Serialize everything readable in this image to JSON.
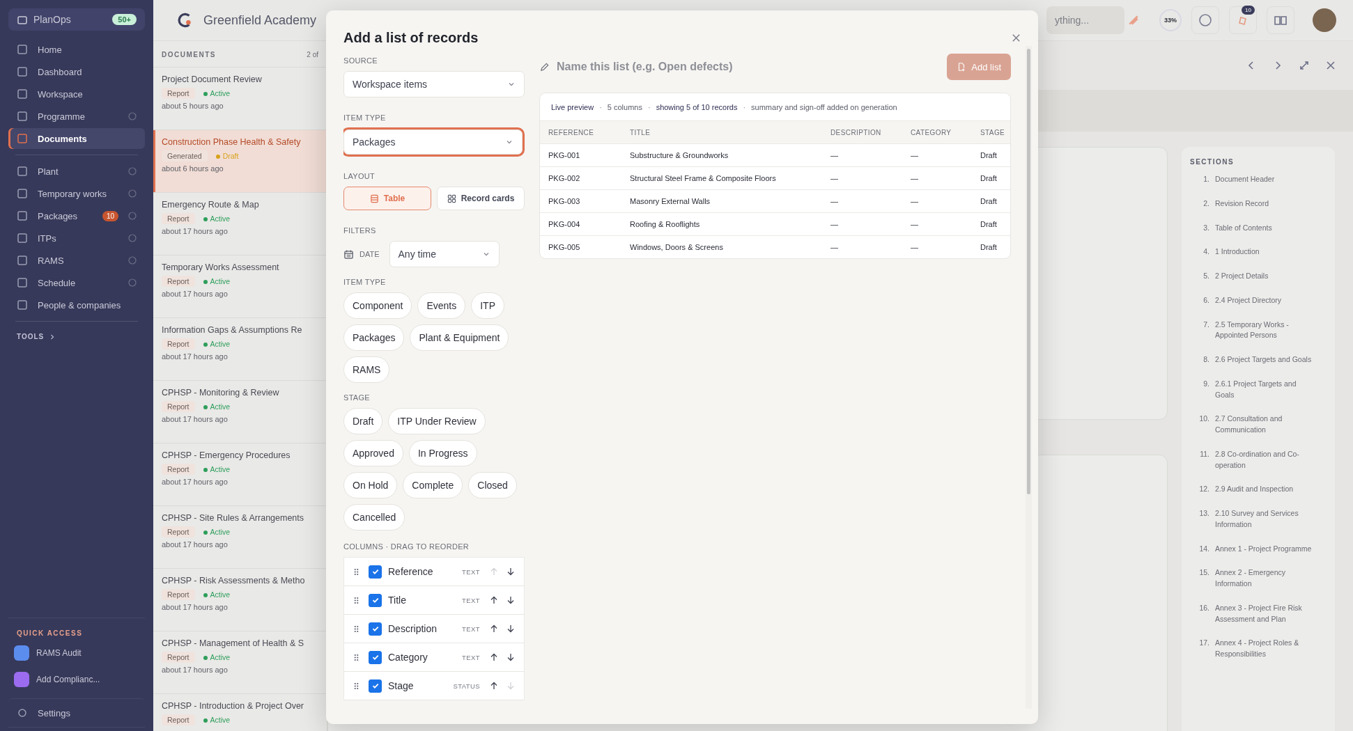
{
  "sidebar": {
    "brand": "PlanOps",
    "brand_badge": "50+",
    "main_items": [
      {
        "label": "Home",
        "selected": false,
        "info": false
      },
      {
        "label": "Dashboard",
        "selected": false,
        "info": false
      },
      {
        "label": "Workspace",
        "selected": false,
        "info": false
      },
      {
        "label": "Programme",
        "selected": false,
        "info": true
      },
      {
        "label": "Documents",
        "selected": true,
        "info": false
      }
    ],
    "project_items": [
      {
        "label": "Plant",
        "info": true
      },
      {
        "label": "Temporary works",
        "info": true
      },
      {
        "label": "Packages",
        "info": true,
        "badge": "10"
      },
      {
        "label": "ITPs",
        "info": true
      },
      {
        "label": "RAMS",
        "info": true
      },
      {
        "label": "Schedule",
        "info": true
      },
      {
        "label": "People & companies",
        "info": false
      }
    ],
    "tools_label": "TOOLS",
    "quick_access": {
      "label": "QUICK ACCESS",
      "items": [
        {
          "label": "RAMS Audit",
          "color": "#5b8def"
        },
        {
          "label": "Add Complianc...",
          "color": "#9b6cf0"
        }
      ]
    },
    "settings": "Settings"
  },
  "header": {
    "project": "Greenfield Academy",
    "search_placeholder": "ything...",
    "progress": "33%",
    "notifications": "10"
  },
  "documents": {
    "title": "DOCUMENTS",
    "count": "2 of",
    "items": [
      {
        "title": "Project Document Review",
        "tag": "Report",
        "status": {
          "label": "Active",
          "color": "#2e9e5b"
        },
        "time": "about 5 hours ago",
        "selected": false
      },
      {
        "title": "Construction Phase Health & Safety",
        "tag": "Generated",
        "status": {
          "label": "Draft",
          "color": "#d9a21b"
        },
        "time": "about 6 hours ago",
        "selected": true
      },
      {
        "title": "Emergency Route & Map",
        "tag": "Report",
        "status": {
          "label": "Active",
          "color": "#2e9e5b"
        },
        "time": "about 17 hours ago",
        "selected": false
      },
      {
        "title": "Temporary Works Assessment",
        "tag": "Report",
        "status": {
          "label": "Active",
          "color": "#2e9e5b"
        },
        "time": "about 17 hours ago",
        "selected": false
      },
      {
        "title": "Information Gaps & Assumptions Re",
        "tag": "Report",
        "status": {
          "label": "Active",
          "color": "#2e9e5b"
        },
        "time": "about 17 hours ago",
        "selected": false
      },
      {
        "title": "CPHSP - Monitoring & Review",
        "tag": "Report",
        "status": {
          "label": "Active",
          "color": "#2e9e5b"
        },
        "time": "about 17 hours ago",
        "selected": false
      },
      {
        "title": "CPHSP - Emergency Procedures",
        "tag": "Report",
        "status": {
          "label": "Active",
          "color": "#2e9e5b"
        },
        "time": "about 17 hours ago",
        "selected": false
      },
      {
        "title": "CPHSP - Site Rules & Arrangements",
        "tag": "Report",
        "status": {
          "label": "Active",
          "color": "#2e9e5b"
        },
        "time": "about 17 hours ago",
        "selected": false
      },
      {
        "title": "CPHSP - Risk Assessments & Metho",
        "tag": "Report",
        "status": {
          "label": "Active",
          "color": "#2e9e5b"
        },
        "time": "about 17 hours ago",
        "selected": false
      },
      {
        "title": "CPHSP - Management of Health & S",
        "tag": "Report",
        "status": {
          "label": "Active",
          "color": "#2e9e5b"
        },
        "time": "about 17 hours ago",
        "selected": false
      },
      {
        "title": "CPHSP - Introduction & Project Over",
        "tag": "Report",
        "status": {
          "label": "Active",
          "color": "#2e9e5b"
        },
        "selected": false
      }
    ]
  },
  "sections": {
    "title": "SECTIONS",
    "items": [
      {
        "number": "1.",
        "title": "Document Header"
      },
      {
        "number": "2.",
        "title": "Revision Record"
      },
      {
        "number": "3.",
        "title": "Table of Contents"
      },
      {
        "number": "4.",
        "title": "1 Introduction"
      },
      {
        "number": "5.",
        "title": "2 Project Details"
      },
      {
        "number": "6.",
        "title": "2.4 Project Directory"
      },
      {
        "number": "7.",
        "title": "2.5 Temporary Works - Appointed Persons"
      },
      {
        "number": "8.",
        "title": "2.6 Project Targets and Goals"
      },
      {
        "number": "9.",
        "title": "2.6.1 Project Targets and Goals"
      },
      {
        "number": "10.",
        "title": "2.7 Consultation and Communication"
      },
      {
        "number": "11.",
        "title": "2.8 Co-ordination and Co-operation"
      },
      {
        "number": "12.",
        "title": "2.9 Audit and Inspection"
      },
      {
        "number": "13.",
        "title": "2.10 Survey and Services Information"
      },
      {
        "number": "14.",
        "title": "Annex 1 - Project Programme"
      },
      {
        "number": "15.",
        "title": "Annex 2 - Emergency Information"
      },
      {
        "number": "16.",
        "title": "Annex 3 - Project Fire Risk Assessment and Plan"
      },
      {
        "number": "17.",
        "title": "Annex 4 - Project Roles & Responsibilities"
      }
    ]
  },
  "modal": {
    "title": "Add a list of records",
    "source": {
      "label": "SOURCE",
      "value": "Workspace items"
    },
    "item_type": {
      "label": "ITEM TYPE",
      "value": "Packages",
      "focused": true
    },
    "layout": {
      "label": "LAYOUT",
      "options": [
        {
          "label": "Table",
          "kind": "table",
          "selected": true
        },
        {
          "label": "Record cards",
          "kind": "cards",
          "selected": false
        }
      ]
    },
    "filters": {
      "label": "FILTERS",
      "date_label": "DATE",
      "date_value": "Any time"
    },
    "item_type_filter": {
      "label": "ITEM TYPE",
      "chips": [
        {
          "label": "Component",
          "selected": false
        },
        {
          "label": "Events",
          "selected": false
        },
        {
          "label": "ITP",
          "selected": false
        },
        {
          "label": "Packages",
          "selected": false
        },
        {
          "label": "Plant & Equipment",
          "selected": false
        },
        {
          "label": "RAMS",
          "selected": false
        }
      ]
    },
    "stage_filter": {
      "label": "STAGE",
      "chips": [
        {
          "label": "Draft",
          "selected": false
        },
        {
          "label": "ITP Under Review",
          "selected": false
        },
        {
          "label": "Approved",
          "selected": false
        },
        {
          "label": "In Progress",
          "selected": false
        },
        {
          "label": "On Hold",
          "selected": false
        },
        {
          "label": "Complete",
          "selected": false
        },
        {
          "label": "Closed",
          "selected": false
        },
        {
          "label": "Cancelled",
          "selected": false
        }
      ]
    },
    "columns": {
      "label": "COLUMNS · DRAG TO REORDER",
      "rows": [
        {
          "name": "Reference",
          "type": "TEXT",
          "checked": true,
          "can_move_up": false,
          "can_move_down": true
        },
        {
          "name": "Title",
          "type": "TEXT",
          "checked": true,
          "can_move_up": true,
          "can_move_down": true
        },
        {
          "name": "Description",
          "type": "TEXT",
          "checked": true,
          "can_move_up": true,
          "can_move_down": true
        },
        {
          "name": "Category",
          "type": "TEXT",
          "checked": true,
          "can_move_up": true,
          "can_move_down": true
        },
        {
          "name": "Stage",
          "type": "STATUS",
          "checked": true,
          "can_move_up": true,
          "can_move_down": false
        }
      ]
    },
    "list_name": {
      "placeholder": "Name this list (e.g. Open defects)"
    },
    "add_button": {
      "label": "Add list",
      "disabled": true
    },
    "preview": {
      "separator": "·",
      "summary": [
        {
          "text": "Live preview",
          "strong": true
        },
        {
          "text": "5 columns",
          "strong": false
        },
        {
          "text": "showing 5 of 10 records",
          "strong": true
        },
        {
          "text": "summary and sign-off added on generation",
          "strong": false
        }
      ],
      "columns": [
        "REFERENCE",
        "TITLE",
        "DESCRIPTION",
        "CATEGORY",
        "STAGE"
      ],
      "rows": [
        [
          "PKG-001",
          "Substructure & Groundworks",
          "—",
          "—",
          "Draft"
        ],
        [
          "PKG-002",
          "Structural Steel Frame & Composite Floors",
          "—",
          "—",
          "Draft"
        ],
        [
          "PKG-003",
          "Masonry External Walls",
          "—",
          "—",
          "Draft"
        ],
        [
          "PKG-004",
          "Roofing & Rooflights",
          "—",
          "—",
          "Draft"
        ],
        [
          "PKG-005",
          "Windows, Doors & Screens",
          "—",
          "—",
          "Draft"
        ]
      ]
    }
  }
}
